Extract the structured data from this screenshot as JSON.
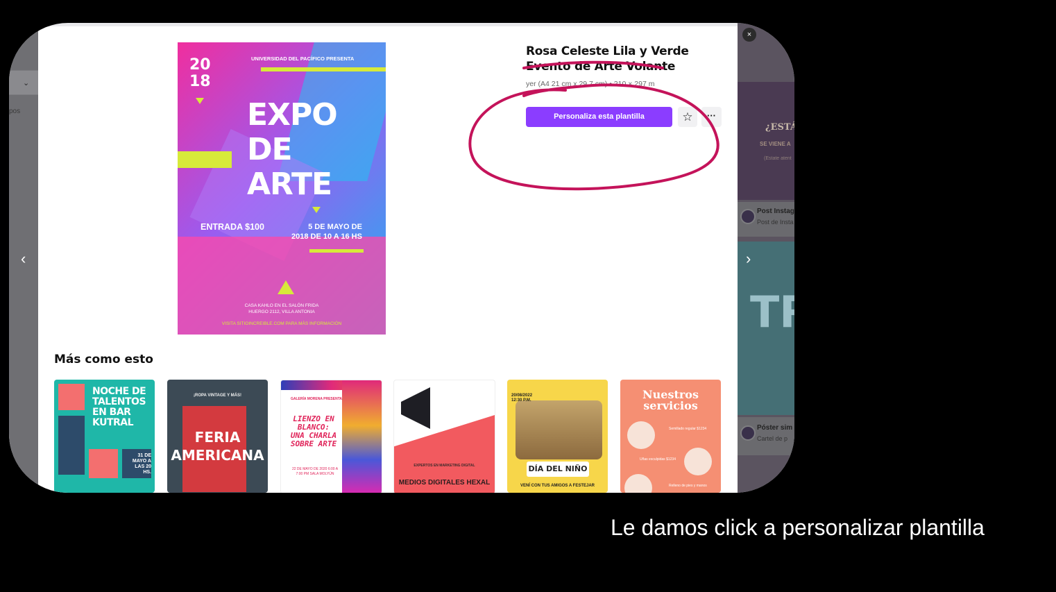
{
  "background_page": {
    "left_filter_label": "pos",
    "right_cards": [
      {
        "title": "Post Instag",
        "subtitle": "Post de Insta",
        "preview_text": "¿ESTÁ",
        "preview_sub": "SE VIENE A",
        "preview_small": "(Estate atent"
      },
      {
        "title": "Póster sim",
        "subtitle": "Cartel de p",
        "preview_text": "TR"
      }
    ]
  },
  "modal": {
    "close_label": "×",
    "prev_label": "‹",
    "next_label": "›",
    "template": {
      "title": "Rosa Celeste Lila y Verde Evento de Arte Volante",
      "subtitle": "yer (A4 21 cm x 29,7 cm) • 210 × 297 m",
      "customize_label": "Personaliza esta plantilla",
      "star_icon": "☆",
      "more_icon": "···"
    },
    "poster": {
      "year": "20\n18",
      "presenter": "UNIVERSIDAD DEL PACÍFICO PRESENTA",
      "title": "EXPO\nDE\nARTE",
      "entry": "ENTRADA $100",
      "date": "5 DE MAYO DE\n2018 DE 10 A 16 HS",
      "venue": "CASA KAHLO EN EL SALÓN FRIDA\nHUERGO 2112, VILLA ANTONIA",
      "website": "VISITA SITIOINCREIBLE.COM PARA MÁS INFORMACIÓN"
    },
    "more_like_this": {
      "title": "Más como esto",
      "items": [
        {
          "title": "NOCHE DE TALENTOS EN BAR KUTRAL",
          "date": "31 DE MAYO A LAS 20 HS."
        },
        {
          "title": "FERIA AMERICANA",
          "subtitle": "¡ROPA VINTAGE Y MÁS!"
        },
        {
          "title": "LIENZO EN BLANCO: UNA CHARLA SOBRE ARTE",
          "subtitle": "GALERÍA MORENA PRESENTA",
          "date": "22 DE MAYO DE 2020 6:00 A 7:00 PM SALA MOLYÚN"
        },
        {
          "title": "MEDIOS DIGITALES HEXAL",
          "subtitle": "EXPERTOS EN MARKETING DIGITAL"
        },
        {
          "title": "DÍA DEL NIÑO",
          "date": "20/08/2022 12:30 P.M.",
          "subtitle": "VENÍ CON TUS AMIGOS A FESTEJAR"
        },
        {
          "title": "Nuestros servicios",
          "p1": "Semillado regular $1234",
          "p2": "Uñas esculpidas $1234",
          "p3": "Relleno de pies y manos"
        }
      ]
    }
  },
  "caption": "Le damos click a personalizar plantilla",
  "colors": {
    "accent": "#8b3dff",
    "annotation": "#c4135a"
  }
}
